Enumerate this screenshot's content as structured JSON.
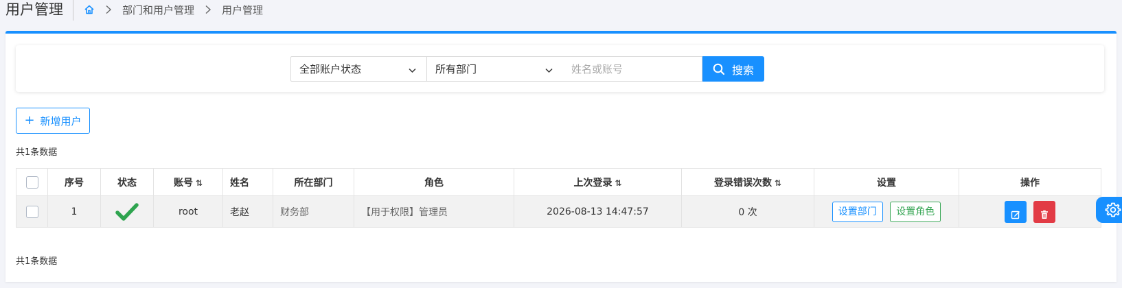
{
  "header": {
    "title": "用户管理",
    "breadcrumb": [
      "部门和用户管理",
      "用户管理"
    ]
  },
  "filters": {
    "status_value": "全部账户状态",
    "dept_value": "所有部门",
    "search_placeholder": "姓名或账号",
    "search_label": "搜索"
  },
  "toolbar": {
    "add_label": "新增用户",
    "count_text": "共1条数据"
  },
  "table": {
    "columns": {
      "index": "序号",
      "status": "状态",
      "account": "账号",
      "name": "姓名",
      "department": "所在部门",
      "role": "角色",
      "last_login": "上次登录",
      "login_errors": "登录错误次数",
      "settings": "设置",
      "actions": "操作"
    },
    "rows": [
      {
        "index": "1",
        "account": "root",
        "name": "老赵",
        "department": "财务部",
        "role": "【用于权限】管理员",
        "last_login": "2026-08-13 14:47:57",
        "login_errors": "0 次",
        "set_dept_label": "设置部门",
        "set_role_label": "设置角色"
      }
    ]
  },
  "footer": {
    "count_text": "共1条数据"
  },
  "icons": {
    "home": "home-icon",
    "chevron": "chevron-right-icon",
    "search": "search-icon",
    "status_ok": "check-icon",
    "edit": "edit-icon",
    "delete": "trash-icon",
    "settings": "gear-icon"
  },
  "colors": {
    "accent": "#1890ff",
    "success": "#2ea44f",
    "danger": "#e23b45"
  }
}
